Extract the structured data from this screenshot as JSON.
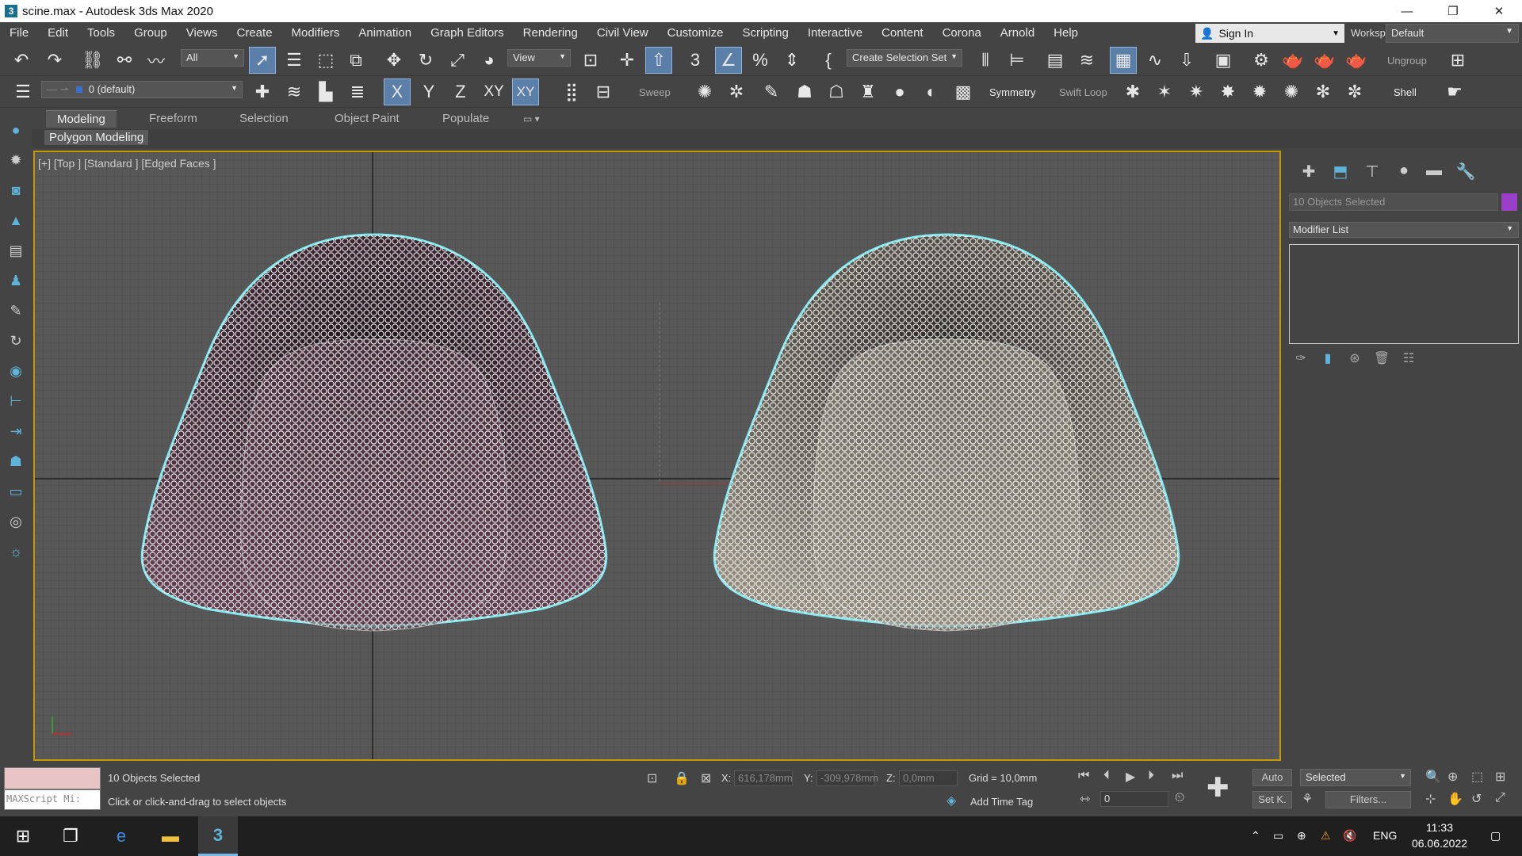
{
  "window": {
    "title": "scine.max - Autodesk 3ds Max 2020",
    "app_icon": "3",
    "minimize": "—",
    "maximize": "❐",
    "close": "✕"
  },
  "menu": {
    "items": [
      "File",
      "Edit",
      "Tools",
      "Group",
      "Views",
      "Create",
      "Modifiers",
      "Animation",
      "Graph Editors",
      "Rendering",
      "Civil View",
      "Customize",
      "Scripting",
      "Interactive",
      "Content",
      "Corona",
      "Arnold",
      "Help"
    ],
    "sign_in": "Sign In",
    "workspaces_label": "Workspaces:",
    "workspace_value": "Default"
  },
  "toolbar1": {
    "filter_value": "All",
    "ref_coord_value": "View",
    "selection_set_placeholder": "Create Selection Set",
    "ungroup_label": "Ungroup"
  },
  "toolbar2": {
    "layer_value": "0 (default)",
    "axis_x": "X",
    "axis_y": "Y",
    "axis_z": "Z",
    "axis_xy": "XY",
    "axis_xy2": "XY",
    "sweep_label": "Sweep",
    "symmetry_label": "Symmetry",
    "swift_loop_label": "Swift Loop",
    "shell_label": "Shell"
  },
  "ribbon": {
    "tabs": [
      "Modeling",
      "Freeform",
      "Selection",
      "Object Paint",
      "Populate"
    ],
    "active_tab": "Modeling",
    "panel_label": "Polygon Modeling"
  },
  "viewport": {
    "label": "[+] [Top ] [Standard ] [Edged Faces ]",
    "left_object_color": "#5a3a48",
    "right_object_color": "#8c8578",
    "selection_outline_color": "#7fe8f0",
    "border_color": "#c49a00"
  },
  "command_panel": {
    "objects_selected": "10 Objects Selected",
    "object_color": "#9b3fc8",
    "modifier_list": "Modifier List"
  },
  "status": {
    "maxscript_placeholder": "MAXScript Mi:",
    "selection_text": "10 Objects Selected",
    "prompt_text": "Click or click-and-drag to select objects",
    "x_label": "X:",
    "x_value": "616,178mm",
    "y_label": "Y:",
    "y_value": "-309,978mm",
    "z_label": "Z:",
    "z_value": "0,0mm",
    "grid_text": "Grid = 10,0mm",
    "add_time_tag": "Add Time Tag",
    "frame_value": "0",
    "auto_key": "Auto",
    "set_key": "Set K.",
    "selected_value": "Selected",
    "filters": "Filters..."
  },
  "taskbar": {
    "lang": "ENG",
    "time": "11:33",
    "date": "06.06.2022"
  }
}
